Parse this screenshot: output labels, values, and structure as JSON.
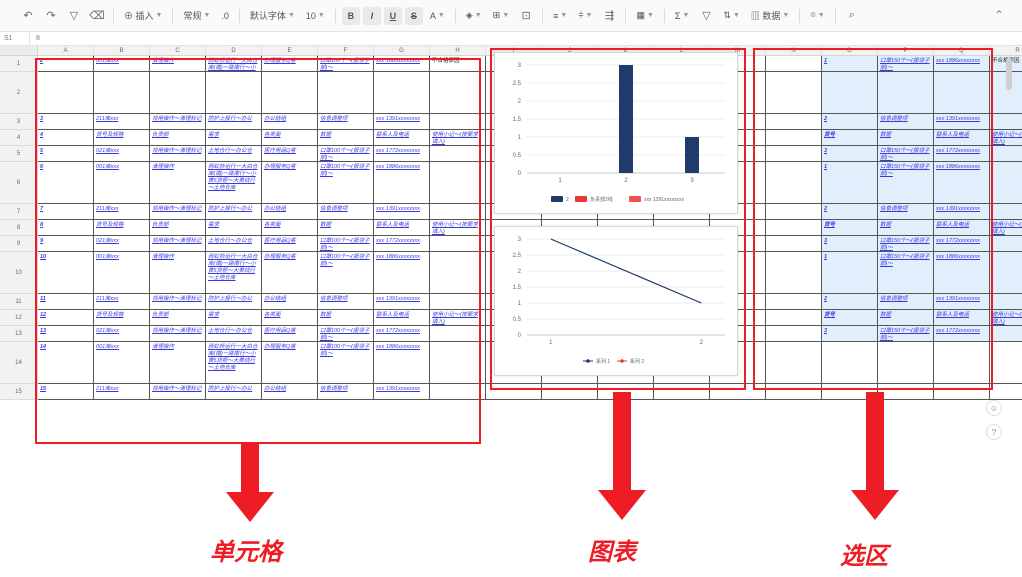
{
  "toolbar": {
    "undo": "↶",
    "redo": "↷",
    "filter": "▽",
    "clear": "⌫",
    "insert": "⊕ 插入",
    "format": "常规",
    "decimal": ".0",
    "font": "默认字体",
    "size": "10",
    "bold": "B",
    "italic": "I",
    "underline": "U",
    "strike": "S",
    "font_color": "A",
    "fill": "◈",
    "border": "⊞",
    "merge": "⊡",
    "align": "≡",
    "valign": "⫩",
    "wrap": "⇶",
    "freeze": "▦",
    "sum": "Σ",
    "sort_filter": "▽",
    "sort": "⇅",
    "data": "▥ 数据",
    "lock": "⌾",
    "search": "⌕",
    "collapse": "⌃"
  },
  "formula_bar": {
    "cell_ref": "S1",
    "value": "8"
  },
  "column_letters": [
    "A",
    "B",
    "C",
    "D",
    "E",
    "F",
    "G",
    "H",
    "I",
    "J",
    "K",
    "L",
    "M",
    "N",
    "O",
    "P",
    "Q",
    "R"
  ],
  "row_numbers": [
    "1",
    "2",
    "3",
    "4",
    "5",
    "6",
    "7",
    "8",
    "9",
    "10",
    "11",
    "12",
    "13",
    "14",
    "15"
  ],
  "cells": {
    "row1": [
      "2",
      "001库xxx",
      "清理操作",
      "西虹桥运行一大白仓库(南)一路南行～小黄5货柜～大黄线行～土地仓库",
      "办理服务Q客",
      "口罩100个～(报领子部)～",
      "xxx 1886xxxxxxxx",
      "不合格原因"
    ],
    "row3": [
      "3",
      "211库xxx",
      "领用操作～清理标记",
      "防护上报行～办公",
      "办公结组",
      "信息调整项",
      "xxx 1391xxxxxxxx",
      ""
    ],
    "row4": [
      "4",
      "货号及规格",
      "负责部",
      "需求",
      "各类面",
      "数据",
      "联系人及电话",
      "使用小记～(按要求填入)"
    ],
    "row5": [
      "5",
      "021库xxx",
      "领用操作～清理标记",
      "土地仓行～办公仓",
      "医疗用品Q客",
      "口罩100个～(报领子部)～",
      "xxx 1772xxxxxxxx",
      ""
    ],
    "row6": [
      "6",
      "001库xxx",
      "清理操作",
      "西虹桥运行一大白仓库(南)一路南行～小黄5货柜～大黄线行～土地仓库",
      "办理服务Q客",
      "口罩100个～(报领子部)～",
      "xxx 1886xxxxxxxx",
      ""
    ],
    "row7": [
      "7",
      "211库xxx",
      "领用操作～清理标记",
      "防护上报行～办公",
      "办公结组",
      "信息调整项",
      "xxx 1391xxxxxxxx",
      ""
    ],
    "row8": [
      "8",
      "货号及规格",
      "负责部",
      "需求",
      "各类面",
      "数据",
      "联系人及电话",
      "使用小记～(按要求填入)"
    ],
    "row9": [
      "9",
      "021库xxx",
      "领用操作～清理标记",
      "土地仓行～办公仓",
      "医疗用品Q客",
      "口罩100个～(报领子部)～",
      "xxx 1772xxxxxxxx",
      ""
    ],
    "row10": [
      "10",
      "001库xxx",
      "清理操作",
      "西虹桥运行一大白仓库(南)一路南行～小黄5货柜～大黄线行～土地仓库",
      "办理服务Q客",
      "口罩100个～(报领子部)～",
      "xxx 1886xxxxxxxx",
      ""
    ],
    "row11": [
      "11",
      "211库xxx",
      "领用操作～清理标记",
      "防护上报行～办公",
      "办公结组",
      "信息调整项",
      "xxx 1391xxxxxxxx",
      ""
    ],
    "row12": [
      "12",
      "货号及规格",
      "负责部",
      "需求",
      "各类面",
      "数据",
      "联系人及电话",
      "使用小记～(按要求填入)"
    ],
    "row13": [
      "13",
      "021库xxx",
      "领用操作～清理标记",
      "土地仓行～办公仓",
      "医疗用品Q客",
      "口罩100个～(报领子部)～",
      "xxx 1772xxxxxxxx",
      ""
    ],
    "row14": [
      "14",
      "001库xxx",
      "清理操作",
      "西虹桥运行一大白仓库(南)一路南行～小黄5货柜～大黄线行～土地仓库",
      "办理服务Q客",
      "口罩100个～(报领子部)～",
      "xxx 1886xxxxxxxx",
      ""
    ],
    "row15": [
      "15",
      "211库xxx",
      "领用操作～清理标记",
      "防护上报行～办公",
      "办公结组",
      "信息调整项",
      "xxx 1391xxxxxxxx",
      ""
    ]
  },
  "selection_cells": {
    "row1": [
      "1",
      "口罩150个～(报领子部)～",
      "xxx 1886xxxxxxxx",
      "不合格原因"
    ],
    "row3": [
      "2",
      "信息调整项",
      "xxx 1391xxxxxxxx",
      ""
    ],
    "row4": [
      "货号",
      "数据",
      "联系人及电话",
      "使用小记～(按要求填入)"
    ],
    "row5": [
      "3",
      "口罩150个～(报领子部)～",
      "xxx 1772xxxxxxxx",
      ""
    ],
    "row6": [
      "1",
      "口罩150个～(报领子部)～",
      "xxx 1886xxxxxxxx",
      ""
    ],
    "row7": [
      "2",
      "信息调整项",
      "xxx 1391xxxxxxxx",
      ""
    ],
    "row8": [
      "货号",
      "数据",
      "联系人及电话",
      "使用小记～(按要求填入)"
    ],
    "row9": [
      "3",
      "口罩150个～(报领子部)～",
      "xxx 1772xxxxxxxx",
      ""
    ],
    "row10": [
      "1",
      "口罩150个～(报领子部)～",
      "xxx 1886xxxxxxxx",
      ""
    ],
    "row11": [
      "2",
      "信息调整项",
      "xxx 1391xxxxxxxx",
      ""
    ],
    "row12": [
      "货号",
      "数据",
      "联系人及电话",
      "使用小记～(按要求填入)"
    ],
    "row13": [
      "3",
      "口罩150个～(报领子部)～",
      "xxx 1772xxxxxxxx",
      ""
    ]
  },
  "chart_data": [
    {
      "type": "bar",
      "categories": [
        "1",
        "2",
        "3"
      ],
      "series": [
        {
          "name": "2",
          "values": [
            0,
            3,
            1
          ],
          "color": "#1f3a6b"
        },
        {
          "name": "负责部2线",
          "values": [
            0,
            0,
            0
          ],
          "color": "#e53935"
        },
        {
          "name": "xxx 1391xxxxxxxx",
          "values": [
            0,
            0,
            0
          ],
          "color": "#ef5350"
        }
      ],
      "yticks": [
        "0",
        "0.5",
        "1",
        "1.5",
        "2",
        "2.5",
        "3"
      ],
      "ylim": [
        0,
        3
      ],
      "legend": "bottom"
    },
    {
      "type": "line",
      "x": [
        "1",
        "2"
      ],
      "series": [
        {
          "name": "系列 1",
          "values": [
            3,
            1
          ],
          "color": "#1f3a6b"
        },
        {
          "name": "系列 2",
          "values": [],
          "color": "#e53935"
        }
      ],
      "yticks": [
        "0",
        "0.5",
        "1",
        "1.5",
        "2",
        "2.5",
        "3"
      ],
      "ylim": [
        0,
        3
      ],
      "legend": "bottom"
    }
  ],
  "labels": {
    "cells": "单元格",
    "chart": "图表",
    "selection": "选区"
  },
  "side": {
    "help": "?",
    "feedback": "☺"
  },
  "colors": {
    "annotation_red": "#ee1c25",
    "cell_text": "#3a3ae0",
    "selection_fill": "#dce9f7"
  }
}
